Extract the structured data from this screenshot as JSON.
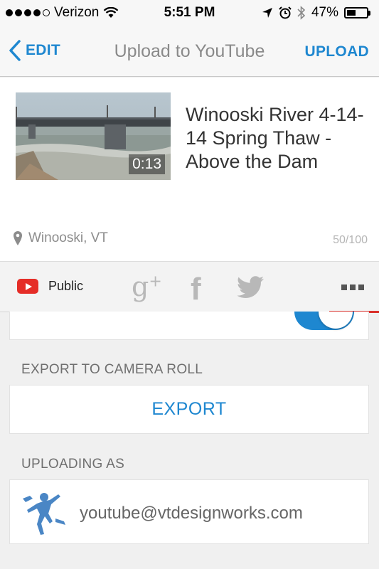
{
  "status_bar": {
    "carrier": "Verizon",
    "time": "5:51 PM",
    "battery_percent": "47%",
    "battery_level": 0.47,
    "icons": [
      "signal-dots",
      "wifi-icon",
      "location-arrow-icon",
      "alarm-icon",
      "bluetooth-icon",
      "battery-icon"
    ]
  },
  "nav": {
    "back_label": "EDIT",
    "title": "Upload to YouTube",
    "action_label": "UPLOAD"
  },
  "video": {
    "duration": "0:13",
    "title": "Winooski River 4-14-14 Spring Thaw - Above the Dam",
    "location": "Winooski, VT",
    "char_count": "50/100"
  },
  "share": {
    "privacy_label": "Public",
    "services": [
      "youtube",
      "google-plus",
      "facebook",
      "twitter",
      "more"
    ],
    "gplus_glyph": "g",
    "gplus_sup": "+",
    "facebook_glyph": "f",
    "accent_color": "#d9302a"
  },
  "toggle": {
    "on": true,
    "color": "#1e87d0"
  },
  "export": {
    "section_label": "EXPORT TO CAMERA ROLL",
    "button_label": "EXPORT"
  },
  "account": {
    "section_label": "UPLOADING AS",
    "email": "youtube@vtdesignworks.com"
  },
  "colors": {
    "accent_blue": "#1e87d0",
    "youtube_red": "#e52d27"
  }
}
